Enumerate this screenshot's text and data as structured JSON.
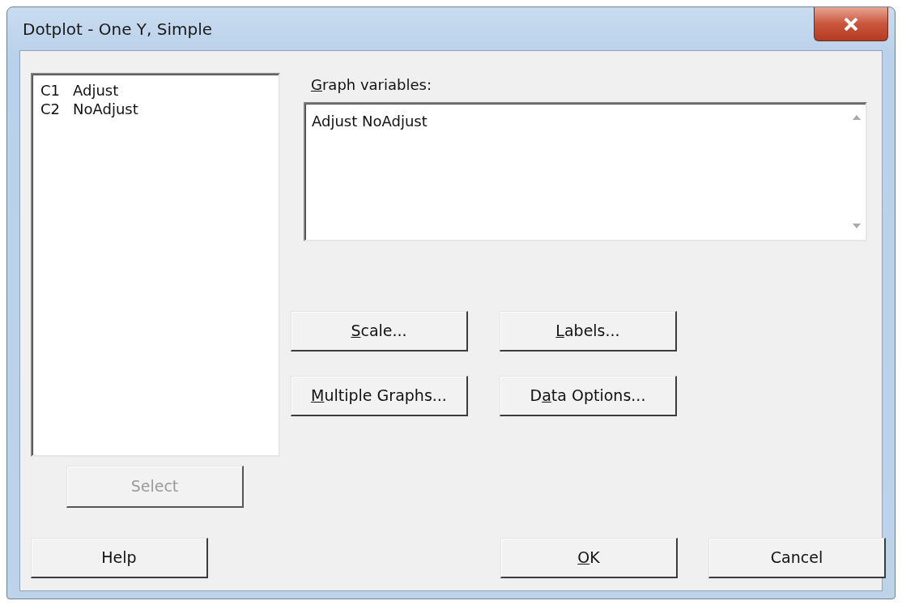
{
  "window": {
    "title": "Dotplot - One Y, Simple"
  },
  "variables": [
    {
      "column": "C1",
      "name": "Adjust"
    },
    {
      "column": "C2",
      "name": "NoAdjust"
    }
  ],
  "graph_variables": {
    "label": {
      "mnemonic": "G",
      "after": "raph variables:"
    },
    "value": "Adjust NoAdjust"
  },
  "option_buttons": [
    {
      "mnemonic": "S",
      "after": "cale..."
    },
    {
      "mnemonic": "L",
      "after": "abels..."
    },
    {
      "mnemonic": "M",
      "after": "ultiple Graphs..."
    },
    {
      "before": "D",
      "mnemonic": "a",
      "after": "ta Options..."
    }
  ],
  "select_button": {
    "label": {
      "before": "Select"
    },
    "disabled": true
  },
  "footer_buttons": [
    {
      "label": {
        "before": "Help"
      },
      "kind": "left"
    },
    {
      "label": {
        "mnemonic": "O",
        "after": "K"
      },
      "kind": "right"
    },
    {
      "label": {
        "before": "Cancel"
      },
      "kind": "right"
    }
  ]
}
